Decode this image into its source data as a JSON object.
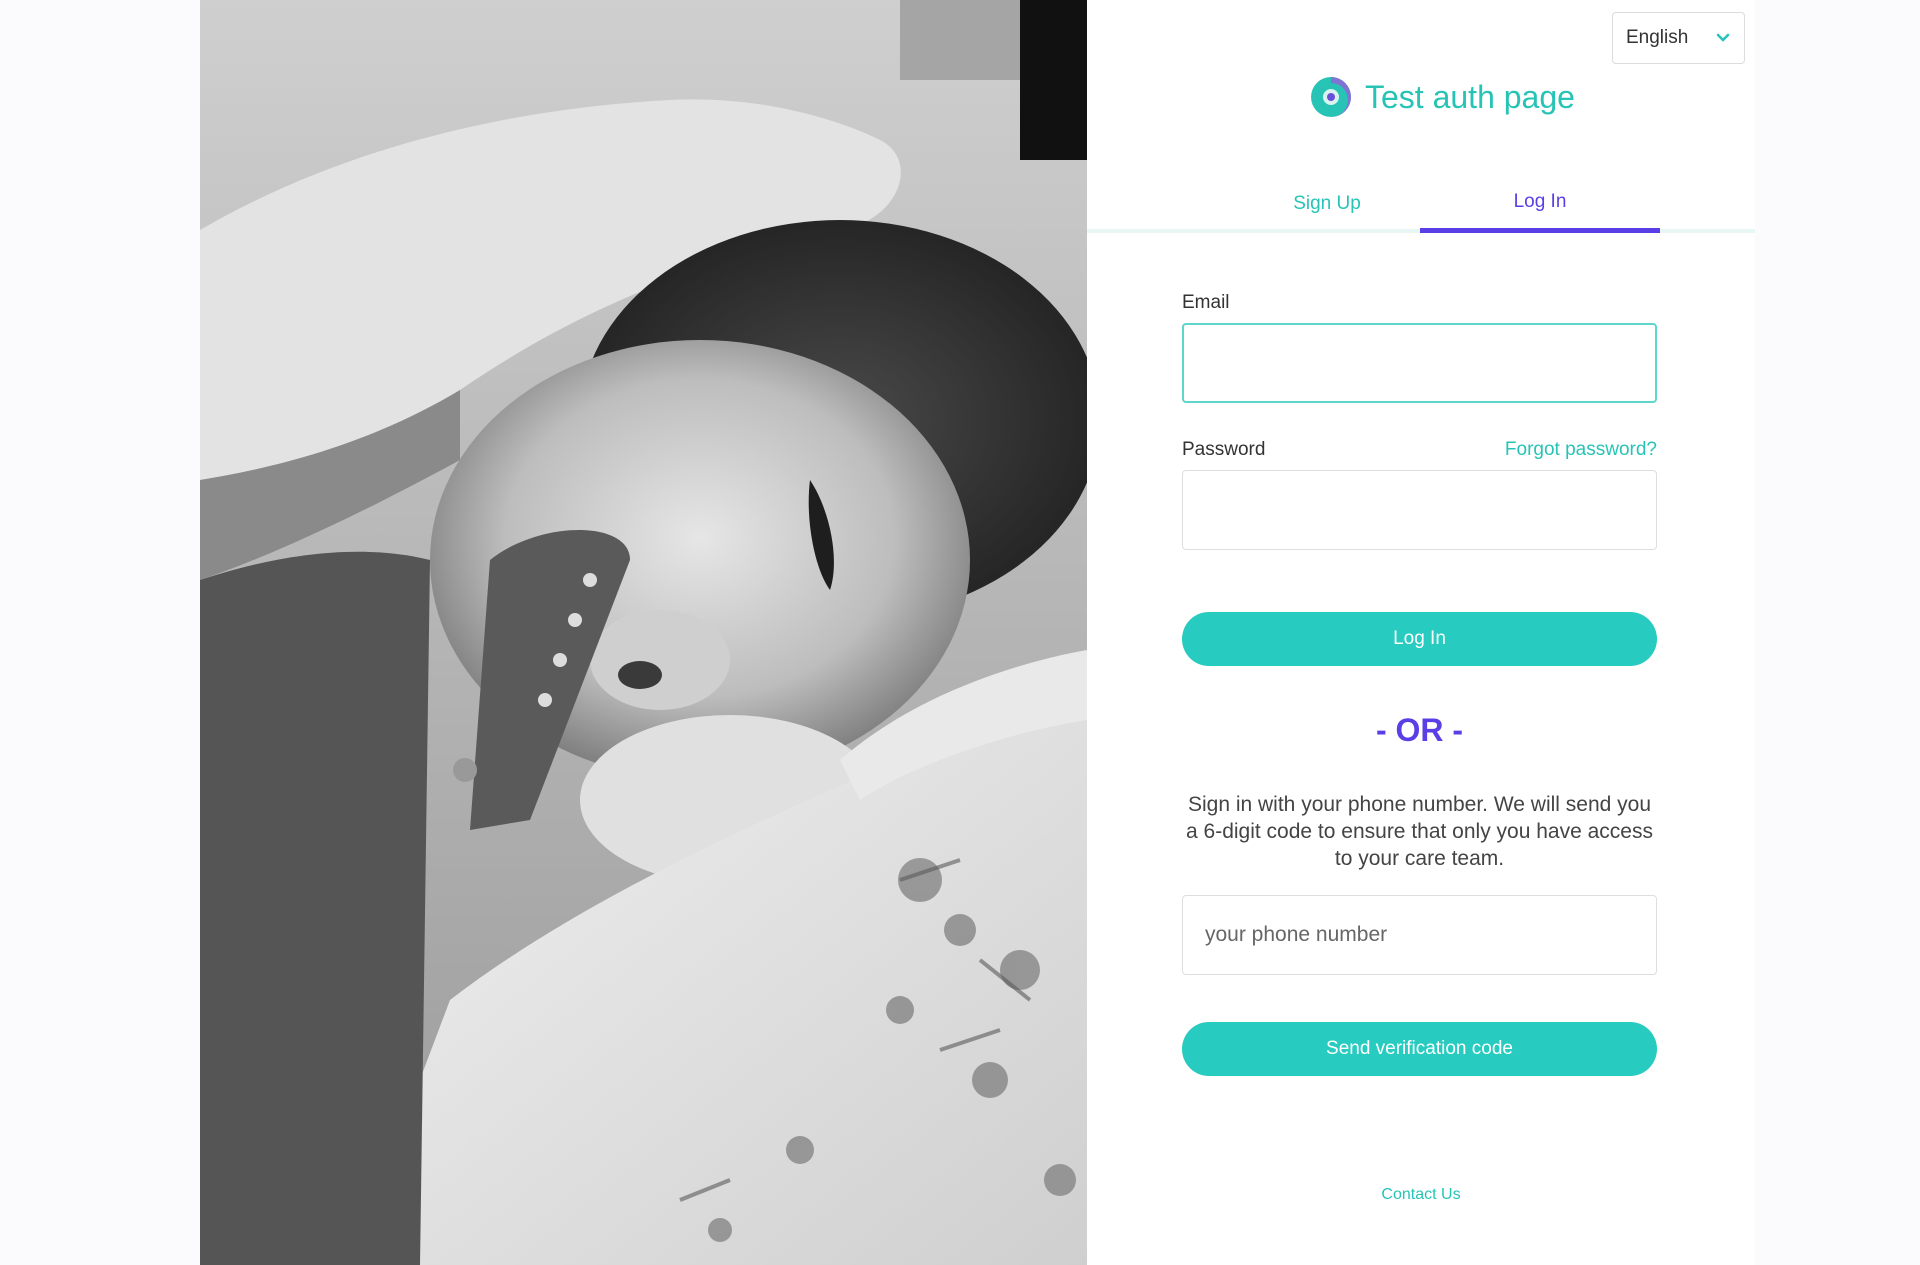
{
  "language": {
    "selected": "English"
  },
  "brand": {
    "title": "Test auth page"
  },
  "tabs": [
    {
      "label": "Sign Up",
      "active": false
    },
    {
      "label": "Log In",
      "active": true
    }
  ],
  "login": {
    "email_label": "Email",
    "email_value": "",
    "password_label": "Password",
    "password_value": "",
    "forgot_label": "Forgot password?",
    "submit_label": "Log In"
  },
  "divider": "- OR -",
  "phone": {
    "help_text": "Sign in with your phone number. We will send you a 6-digit code to ensure that only you have access to your care team.",
    "placeholder": "your phone number",
    "submit_label": "Send verification code"
  },
  "footer": {
    "contact_label": "Contact Us"
  },
  "icons": {
    "logo": "swirl-logo-icon",
    "language_chevron": "chevron-down-icon"
  },
  "colors": {
    "accent_teal": "#27cbbf",
    "accent_purple": "#5a3ee6"
  }
}
